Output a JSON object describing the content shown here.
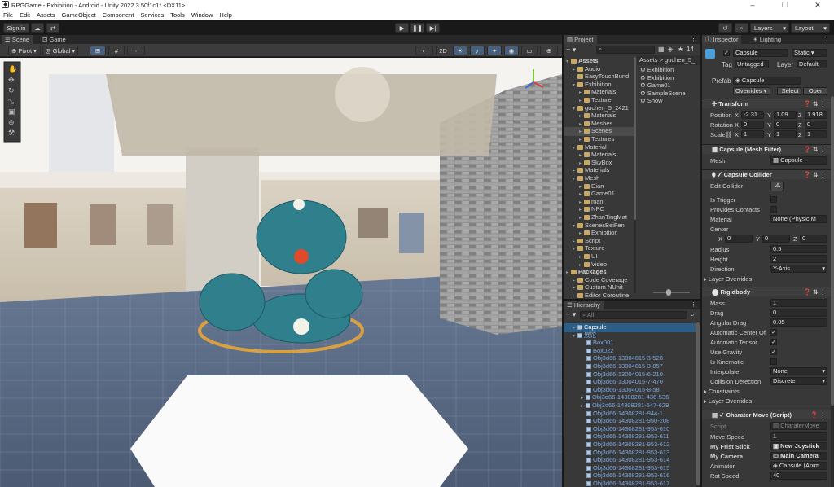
{
  "title": "RPGGame - Exhibition - Android - Unity 2022.3.50f1c1* <DX11>",
  "menu": [
    "File",
    "Edit",
    "Assets",
    "GameObject",
    "Component",
    "Services",
    "Tools",
    "Window",
    "Help"
  ],
  "toolbar": {
    "signin": "Sign in",
    "layers": "Layers",
    "layout": "Layout"
  },
  "scene": {
    "tab_scene": "Scene",
    "tab_game": "Game",
    "pivot": "Pivot",
    "global": "Global",
    "mode2d": "2D"
  },
  "project": {
    "tab": "Project",
    "count": "14",
    "tree": [
      {
        "label": "Assets",
        "depth": 0,
        "open": true,
        "bold": true
      },
      {
        "label": "Audio",
        "depth": 1
      },
      {
        "label": "EasyTouchBund",
        "depth": 1
      },
      {
        "label": "Exhibition",
        "depth": 1,
        "open": true
      },
      {
        "label": "Materials",
        "depth": 2
      },
      {
        "label": "Texture",
        "depth": 2
      },
      {
        "label": "guchen_5_2421",
        "depth": 1,
        "open": true
      },
      {
        "label": "Materials",
        "depth": 2
      },
      {
        "label": "Meshes",
        "depth": 2
      },
      {
        "label": "Scenes",
        "depth": 2,
        "sel": true
      },
      {
        "label": "Textures",
        "depth": 2
      },
      {
        "label": "Material",
        "depth": 1,
        "open": true
      },
      {
        "label": "Materials",
        "depth": 2
      },
      {
        "label": "SkyBox",
        "depth": 2
      },
      {
        "label": "Materials",
        "depth": 1
      },
      {
        "label": "Mesh",
        "depth": 1,
        "open": true
      },
      {
        "label": "Dian",
        "depth": 2
      },
      {
        "label": "Game01",
        "depth": 2
      },
      {
        "label": "man",
        "depth": 2
      },
      {
        "label": "NPC",
        "depth": 2
      },
      {
        "label": "ZhanTingMat",
        "depth": 2
      },
      {
        "label": "ScenesBeiFen",
        "depth": 1,
        "open": true
      },
      {
        "label": "Exhibition",
        "depth": 2
      },
      {
        "label": "Script",
        "depth": 1
      },
      {
        "label": "Texture",
        "depth": 1,
        "open": true
      },
      {
        "label": "UI",
        "depth": 2
      },
      {
        "label": "Video",
        "depth": 2
      },
      {
        "label": "Packages",
        "depth": 0,
        "bold": true
      },
      {
        "label": "Code Coverage",
        "depth": 1
      },
      {
        "label": "Custom NUnit",
        "depth": 1
      },
      {
        "label": "Editor Coroutine",
        "depth": 1
      }
    ],
    "breadcrumb": "Assets > guchen_5_",
    "files": [
      "Exhibition",
      "Exhibition",
      "Game01",
      "SampleScene",
      "Show"
    ]
  },
  "hierarchy": {
    "tab": "Hierarchy",
    "search_placeholder": "All",
    "items": [
      {
        "label": "Capsule",
        "depth": 1,
        "sel": true
      },
      {
        "label": "展馆",
        "depth": 1,
        "open": true
      },
      {
        "label": "Box001",
        "depth": 2
      },
      {
        "label": "Box022",
        "depth": 2
      },
      {
        "label": "Obj3d66-13004015-3-528",
        "depth": 2
      },
      {
        "label": "Obj3d66-13004015-3-857",
        "depth": 2
      },
      {
        "label": "Obj3d66-13004015-6-210",
        "depth": 2
      },
      {
        "label": "Obj3d66-13004015-7-470",
        "depth": 2
      },
      {
        "label": "Obj3d66-13004015-8-58",
        "depth": 2
      },
      {
        "label": "Obj3d66-14308281-436-536",
        "depth": 2,
        "arrow": true
      },
      {
        "label": "Obj3d66-14308281-547-629",
        "depth": 2,
        "arrow": true
      },
      {
        "label": "Obj3d66-14308281-944-1",
        "depth": 2
      },
      {
        "label": "Obj3d66-14308281-950-208",
        "depth": 2
      },
      {
        "label": "Obj3d66-14308281-953-610",
        "depth": 2
      },
      {
        "label": "Obj3d66-14308281-953-611",
        "depth": 2
      },
      {
        "label": "Obj3d66-14308281-953-612",
        "depth": 2
      },
      {
        "label": "Obj3d66-14308281-953-613",
        "depth": 2
      },
      {
        "label": "Obj3d66-14308281-953-614",
        "depth": 2
      },
      {
        "label": "Obj3d66-14308281-953-615",
        "depth": 2
      },
      {
        "label": "Obj3d66-14308281-953-616",
        "depth": 2
      },
      {
        "label": "Obj3d66-14308281-953-617",
        "depth": 2
      }
    ]
  },
  "inspector": {
    "tab": "Inspector",
    "tab2": "Lighting",
    "name": "Capsule",
    "static": "Static",
    "tag_label": "Tag",
    "tag": "Untagged",
    "layer_label": "Layer",
    "layer": "Default",
    "prefab_label": "Prefab",
    "prefab": "Capsule",
    "overrides": "Overrides",
    "select": "Select",
    "open": "Open",
    "transform": {
      "title": "Transform",
      "pos_label": "Position",
      "rot_label": "Rotation",
      "scale_label": "Scale",
      "pos": [
        "-2.31",
        "1.09",
        "1.918"
      ],
      "rot": [
        "0",
        "0",
        "0"
      ],
      "scale": [
        "1",
        "1",
        "1"
      ]
    },
    "mesh_filter": {
      "title": "Capsule (Mesh Filter)",
      "mesh_label": "Mesh",
      "mesh": "Capsule"
    },
    "collider": {
      "title": "Capsule Collider",
      "edit": "Edit Collider",
      "is_trigger": "Is Trigger",
      "provides": "Provides Contacts",
      "material": "Material",
      "material_val": "None (Physic M",
      "center": "Center",
      "center_vals": [
        "0",
        "0",
        "0"
      ],
      "radius": "Radius",
      "radius_val": "0.5",
      "height": "Height",
      "height_val": "2",
      "direction": "Direction",
      "direction_val": "Y-Axis",
      "layer_overrides": "Layer Overrides"
    },
    "rigidbody": {
      "title": "Rigidbody",
      "mass": "Mass",
      "mass_val": "1",
      "drag": "Drag",
      "drag_val": "0",
      "angular": "Angular Drag",
      "angular_val": "0.05",
      "auto_center": "Automatic Center Of",
      "auto_tensor": "Automatic Tensor",
      "gravity": "Use Gravity",
      "kinematic": "Is Kinematic",
      "interpolate": "Interpolate",
      "interpolate_val": "None",
      "collision": "Collision Detection",
      "collision_val": "Discrete",
      "constraints": "Constraints",
      "layer_overrides": "Layer Overrides"
    },
    "script": {
      "title": "Charater Move (Script)",
      "script_label": "Script",
      "script_val": "CharaterMove",
      "speed": "Move Speed",
      "speed_val": "1",
      "stick": "My Frist Stick",
      "stick_val": "New Joystick",
      "camera": "My Camera",
      "camera_val": "Main Camera",
      "animator": "Animator",
      "animator_val": "Capsule (Anim",
      "rot": "Rot Speed",
      "rot_val": "40"
    }
  }
}
